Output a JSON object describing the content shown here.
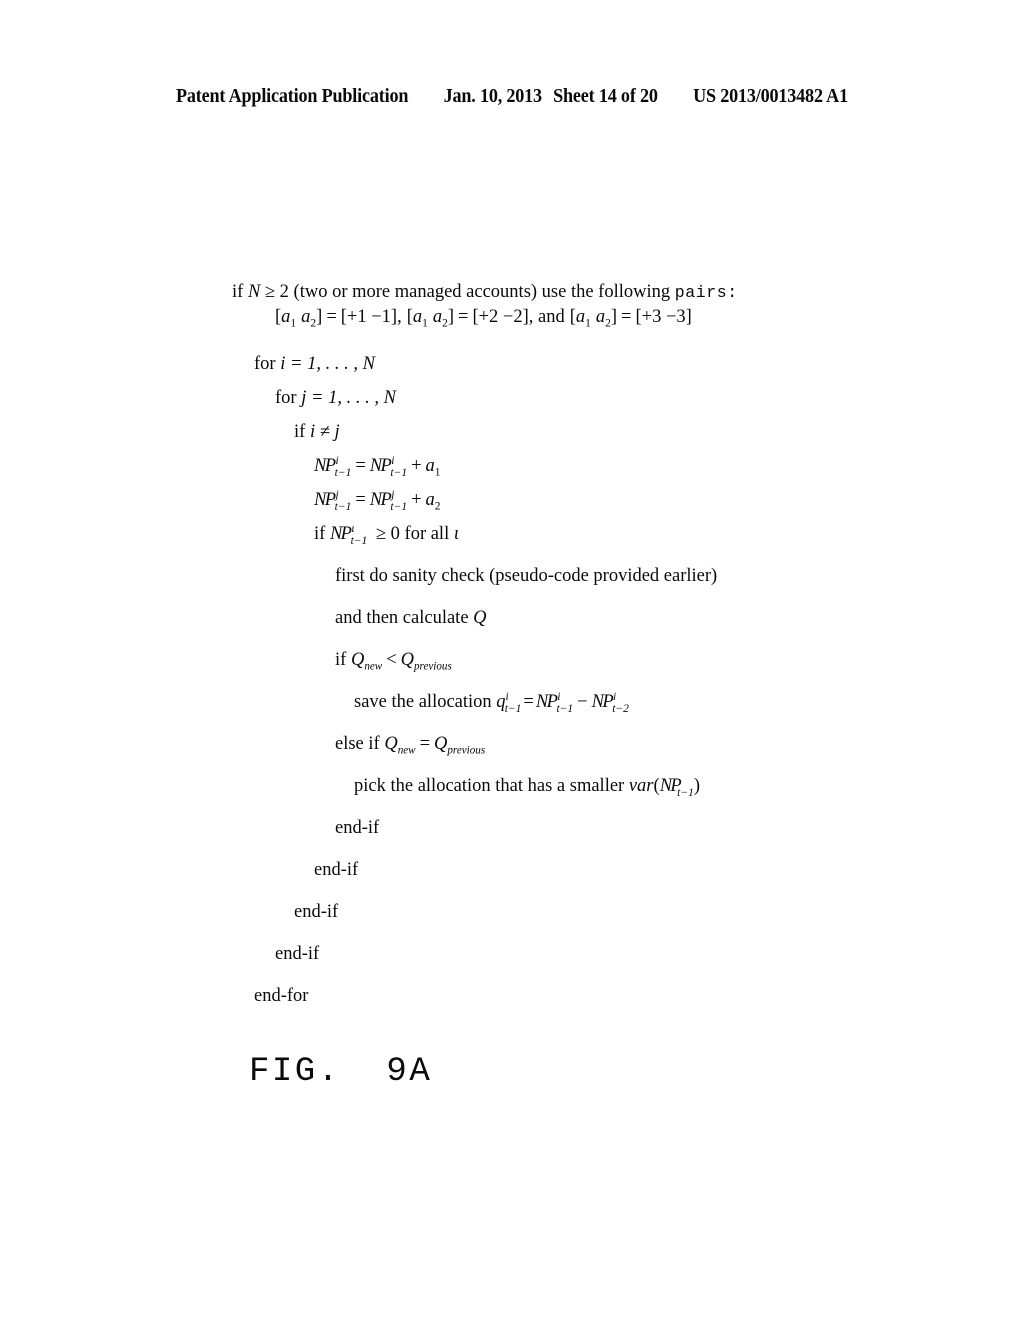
{
  "header": {
    "publication": "Patent Application Publication",
    "date": "Jan. 10, 2013",
    "sheet": "Sheet 14 of 20",
    "patent_number": "US 2013/0013482 A1"
  },
  "figure": {
    "caption": "FIG.  9A"
  },
  "pseudocode": {
    "intro_line1_a": "if",
    "intro_line1_N": "N",
    "intro_line1_b": "≥ 2 (two or more managed accounts) use the following",
    "intro_line1_pairs": "pairs:",
    "pairs_line": {
      "a_open": "[",
      "a1": "a",
      "a1sub": "1",
      "a2": "a",
      "a2sub": "2",
      "a_close": "]",
      "eq": "=",
      "v1": "[+1   −1],",
      "v2": "[+2   −2], and",
      "v3": "[+3   −3]"
    },
    "for_i": {
      "kw": "for",
      "var": "i",
      "range": "= 1, . . . , N"
    },
    "for_j": {
      "kw": "for",
      "var": "j",
      "range": "= 1, . . . , N"
    },
    "if_ij": {
      "kw": "if",
      "expr": "i ≠ j"
    },
    "eq_i": {
      "lhs_base": "NP",
      "lhs_sup": "i",
      "lhs_sub": "t−1",
      "eq": "=",
      "rhs_base": "NP",
      "rhs_sup": "i",
      "rhs_sub": "t−1",
      "plus": "+",
      "term": "a",
      "term_sub": "1"
    },
    "eq_j": {
      "lhs_base": "NP",
      "lhs_sup": "j",
      "lhs_sub": "t−1",
      "eq": "=",
      "rhs_base": "NP",
      "rhs_sup": "j",
      "rhs_sub": "t−1",
      "plus": "+",
      "term": "a",
      "term_sub": "2"
    },
    "if_nonneg": {
      "kw": "if",
      "base": "NP",
      "sup": "ι",
      "sub": "t−1",
      "cond": "≥ 0 for all",
      "index": "ι"
    },
    "sanity_check": "first do sanity check (pseudo-code provided earlier)",
    "calculate_q": {
      "text": "and then calculate",
      "var": "Q"
    },
    "if_q_less": {
      "kw": "if",
      "lhs": "Q",
      "lhs_sub": "new",
      "op": "<",
      "rhs": "Q",
      "rhs_sub": "previous"
    },
    "save_allocation": {
      "text": "save the allocation",
      "q_base": "q",
      "q_sup": "i",
      "q_sub": "t−1",
      "eq": "=",
      "t1_base": "NP",
      "t1_sup": "i",
      "t1_sub": "t−1",
      "minus": "−",
      "t2_base": "NP",
      "t2_sup": "i",
      "t2_sub": "t−2"
    },
    "else_if_q_eq": {
      "kw": "else if",
      "lhs": "Q",
      "lhs_sub": "new",
      "op": "=",
      "rhs": "Q",
      "rhs_sub": "previous"
    },
    "pick_allocation": {
      "text": "pick the allocation that has a smaller",
      "func": "var",
      "open": "(",
      "base": "NP",
      "sub": "t−1",
      "close": ")"
    },
    "end_if_1": "end-if",
    "end_if_2": "end-if",
    "end_if_3": "end-if",
    "end_if_4": "end-if",
    "end_for": "end-for"
  }
}
